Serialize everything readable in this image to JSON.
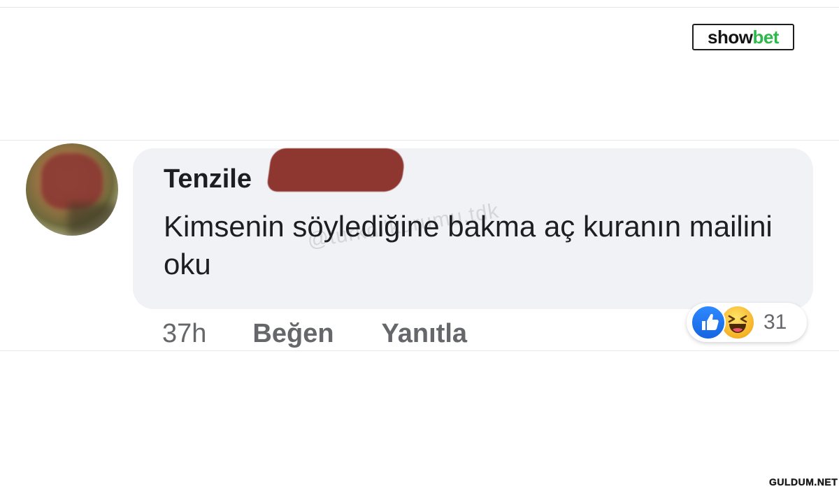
{
  "brand": {
    "name_part1": "show",
    "name_part2": "bet",
    "accent_color": "#2db84b"
  },
  "comment": {
    "author_name": "Tenzile",
    "text": "Kimsenin söylediğine bakma aç kuranın mailini oku",
    "watermark": "@turkdilkurumu.tdk",
    "timestamp": "37h",
    "like_label": "Beğen",
    "reply_label": "Yanıtla",
    "reactions": {
      "icons": [
        "like-icon",
        "haha-icon"
      ],
      "count": "31"
    }
  },
  "footer": {
    "site_logo": "GULDUM.NET"
  }
}
